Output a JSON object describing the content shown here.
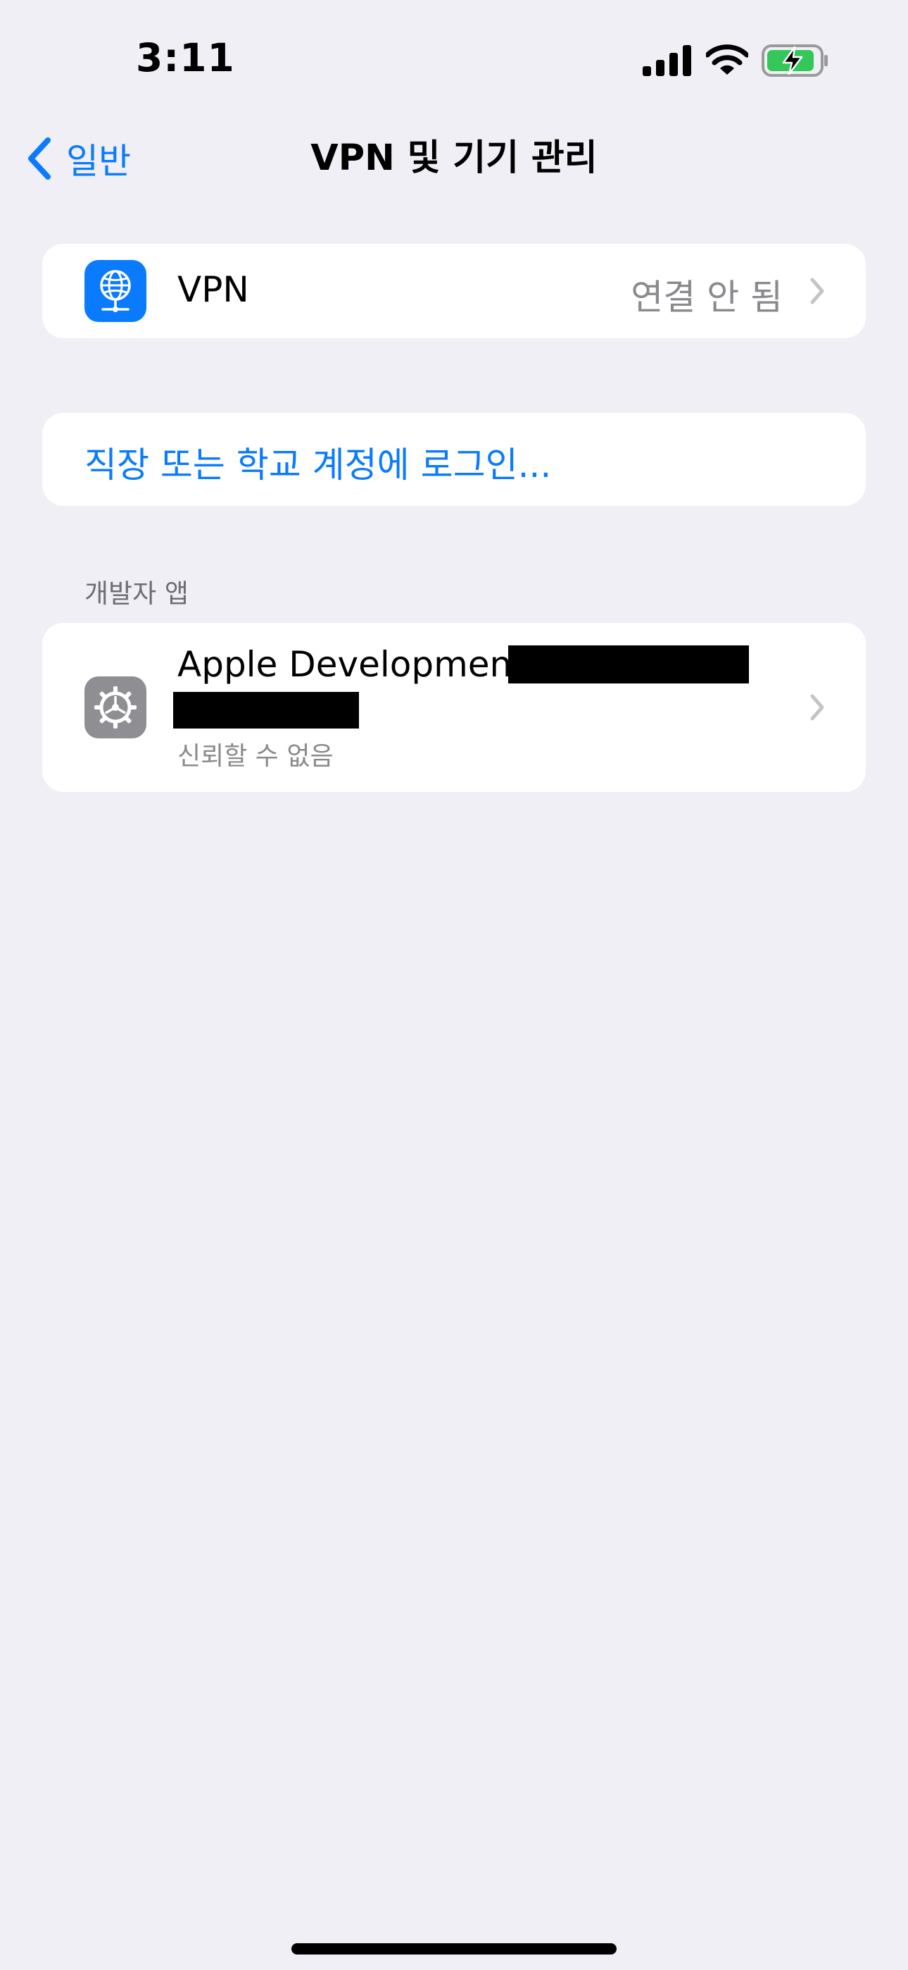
{
  "status_bar": {
    "time": "3:11",
    "icons": [
      "cellular-signal-icon",
      "wifi-icon",
      "battery-charging-icon"
    ]
  },
  "nav": {
    "back_label": "일반",
    "title": "VPN 및 기기 관리"
  },
  "vpn_row": {
    "icon": "vpn-globe-icon",
    "title": "VPN",
    "value": "연결 안 됨"
  },
  "login_row": {
    "label": "직장 또는 학교 계정에 로그인..."
  },
  "developer_section": {
    "header": "개발자 앱",
    "app": {
      "icon": "settings-gear-icon",
      "title": "Apple Development:",
      "subtitle": "신뢰할 수 없음"
    }
  },
  "colors": {
    "background": "#F0EFF5",
    "accent": "#0A7AFF",
    "secondary_text": "#8A8A8E",
    "battery_green": "#34C759"
  }
}
